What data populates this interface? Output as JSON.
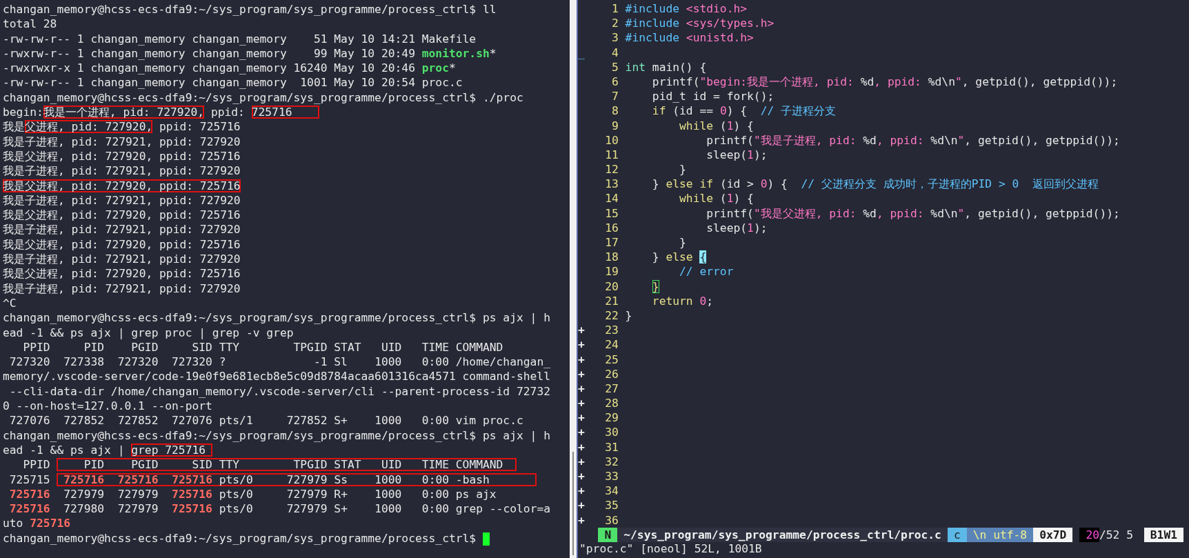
{
  "terminal": {
    "cursor": true,
    "lines": [
      {
        "segments": [
          {
            "kind": "plain",
            "text": "changan_memory@hcss-ecs-dfa9:~/sys_program/sys_programme/process_ctrl$ ll"
          }
        ]
      },
      {
        "segments": [
          {
            "kind": "plain",
            "text": "total 28"
          }
        ]
      },
      {
        "segments": [
          {
            "kind": "plain",
            "text": "-rw-rw-r-- 1 changan_memory changan_memory    51 May 10 14:21 Makefile"
          }
        ]
      },
      {
        "segments": [
          {
            "kind": "plain",
            "text": "-rwxrw-r-- 1 changan_memory changan_memory    99 May 10 20:49 "
          },
          {
            "kind": "exec",
            "text": "monitor.sh"
          },
          {
            "kind": "plain",
            "text": "*"
          }
        ]
      },
      {
        "segments": [
          {
            "kind": "plain",
            "text": "-rwxrwxr-x 1 changan_memory changan_memory 16240 May 10 20:46 "
          },
          {
            "kind": "exec",
            "text": "proc"
          },
          {
            "kind": "plain",
            "text": "*"
          }
        ]
      },
      {
        "segments": [
          {
            "kind": "plain",
            "text": "-rw-rw-r-- 1 changan_memory changan_memory  1001 May 10 20:54 proc.c"
          }
        ]
      },
      {
        "segments": [
          {
            "kind": "plain",
            "text": "changan_memory@hcss-ecs-dfa9:~/sys_program/sys_programme/process_ctrl$ ./proc"
          }
        ]
      },
      {
        "segments": [
          {
            "kind": "plain",
            "text": "begin:"
          },
          {
            "kind": "box",
            "segments": [
              {
                "kind": "plain",
                "text": "我是一个进程, pid: 727920,"
              }
            ]
          },
          {
            "kind": "plain",
            "text": " ppid: "
          },
          {
            "kind": "box",
            "segments": [
              {
                "kind": "plain",
                "text": "725716    "
              }
            ]
          }
        ]
      },
      {
        "segments": [
          {
            "kind": "plain",
            "text": "我是"
          },
          {
            "kind": "box",
            "segments": [
              {
                "kind": "plain",
                "text": "父进程, pid: 727920,"
              }
            ]
          },
          {
            "kind": "plain",
            "text": " ppid: 725716"
          }
        ]
      },
      {
        "segments": [
          {
            "kind": "plain",
            "text": "我是子进程, pid: 727921, ppid: 727920"
          }
        ]
      },
      {
        "segments": [
          {
            "kind": "plain",
            "text": "我是父进程, pid: 727920, ppid: 725716"
          }
        ]
      },
      {
        "segments": [
          {
            "kind": "plain",
            "text": "我是子进程, pid: 727921, ppid: 727920"
          }
        ]
      },
      {
        "segments": [
          {
            "kind": "box",
            "segments": [
              {
                "kind": "plain",
                "text": "我是父进程, pid: 727920, ppid: 725716"
              }
            ]
          }
        ]
      },
      {
        "segments": [
          {
            "kind": "plain",
            "text": "我是子进程, pid: 727921, ppid: 727920"
          }
        ]
      },
      {
        "segments": [
          {
            "kind": "plain",
            "text": "我是父进程, pid: 727920, ppid: 725716"
          }
        ]
      },
      {
        "segments": [
          {
            "kind": "plain",
            "text": "我是子进程, pid: 727921, ppid: 727920"
          }
        ]
      },
      {
        "segments": [
          {
            "kind": "plain",
            "text": "我是父进程, pid: 727920, ppid: 725716"
          }
        ]
      },
      {
        "segments": [
          {
            "kind": "plain",
            "text": "我是子进程, pid: 727921, ppid: 727920"
          }
        ]
      },
      {
        "segments": [
          {
            "kind": "plain",
            "text": "我是父进程, pid: 727920, ppid: 725716"
          }
        ]
      },
      {
        "segments": [
          {
            "kind": "plain",
            "text": "我是子进程, pid: 727921, ppid: 727920"
          }
        ]
      },
      {
        "segments": [
          {
            "kind": "plain",
            "text": "^C"
          }
        ]
      },
      {
        "segments": [
          {
            "kind": "plain",
            "text": "changan_memory@hcss-ecs-dfa9:~/sys_program/sys_programme/process_ctrl$ ps ajx | h"
          }
        ]
      },
      {
        "segments": [
          {
            "kind": "plain",
            "text": "ead -1 && ps ajx | grep proc | grep -v grep"
          }
        ]
      },
      {
        "segments": [
          {
            "kind": "plain",
            "text": "   PPID     PID    PGID     SID TTY        TPGID STAT   UID   TIME COMMAND"
          }
        ]
      },
      {
        "segments": [
          {
            "kind": "plain",
            "text": " 727320  727338  727320  727320 ?             -1 Sl    1000   0:00 /home/changan_"
          }
        ]
      },
      {
        "segments": [
          {
            "kind": "plain",
            "text": "memory/.vscode-server/code-19e0f9e681ecb8e5c09d8784acaa601316ca4571 command-shell"
          }
        ]
      },
      {
        "segments": [
          {
            "kind": "plain",
            "text": " --cli-data-dir /home/changan_memory/.vscode-server/cli --parent-process-id 72732"
          }
        ]
      },
      {
        "segments": [
          {
            "kind": "plain",
            "text": "0 --on-host=127.0.0.1 --on-port"
          }
        ]
      },
      {
        "segments": [
          {
            "kind": "plain",
            "text": " 727076  727852  727852  727076 pts/1     727852 S+    1000   0:00 vim proc.c"
          }
        ]
      },
      {
        "segments": [
          {
            "kind": "plain",
            "text": "changan_memory@hcss-ecs-dfa9:~/sys_program/sys_programme/process_ctrl$ ps ajx | h"
          }
        ]
      },
      {
        "segments": [
          {
            "kind": "plain",
            "text": "ead -1 && ps ajx | "
          },
          {
            "kind": "box",
            "segments": [
              {
                "kind": "plain",
                "text": "grep 725716 "
              }
            ]
          }
        ]
      },
      {
        "segments": [
          {
            "kind": "plain",
            "text": "   PPID "
          },
          {
            "kind": "box",
            "segments": [
              {
                "kind": "plain",
                "text": "    PID    PGID     SID TTY        TPGID STAT   UID   TIME COMMAND  "
              }
            ]
          }
        ]
      },
      {
        "segments": [
          {
            "kind": "plain",
            "text": " 725715 "
          },
          {
            "kind": "box",
            "segments": [
              {
                "kind": "match",
                "text": " 725716"
              },
              {
                "kind": "match",
                "text": "  725716"
              },
              {
                "kind": "match",
                "text": "  725716"
              },
              {
                "kind": "plain",
                "text": " pts/0     727979 Ss    1000   0:00 -bash       "
              }
            ]
          }
        ]
      },
      {
        "segments": [
          {
            "kind": "match",
            "text": " 725716"
          },
          {
            "kind": "plain",
            "text": "  727979  727979  "
          },
          {
            "kind": "match",
            "text": "725716"
          },
          {
            "kind": "plain",
            "text": " pts/0     727979 R+    1000   0:00 ps ajx"
          }
        ]
      },
      {
        "segments": [
          {
            "kind": "match",
            "text": " 725716"
          },
          {
            "kind": "plain",
            "text": "  727980  727979  "
          },
          {
            "kind": "match",
            "text": "725716"
          },
          {
            "kind": "plain",
            "text": " pts/0     727979 S+    1000   0:00 grep --color=a"
          }
        ]
      },
      {
        "segments": [
          {
            "kind": "plain",
            "text": "uto "
          },
          {
            "kind": "match",
            "text": "725716"
          }
        ]
      },
      {
        "segments": [
          {
            "kind": "plain",
            "text": "changan_memory@hcss-ecs-dfa9:~/sys_program/sys_programme/process_ctrl$ "
          }
        ]
      }
    ]
  },
  "editor": {
    "lines": [
      {
        "number": "1",
        "segments": [
          {
            "kind": "preproc",
            "text": "#include"
          },
          {
            "kind": "header",
            "text": " <stdio.h>"
          }
        ]
      },
      {
        "number": "2",
        "segments": [
          {
            "kind": "preproc",
            "text": "#include"
          },
          {
            "kind": "header",
            "text": " <sys/types.h>"
          }
        ]
      },
      {
        "number": "3",
        "segments": [
          {
            "kind": "preproc",
            "text": "#include"
          },
          {
            "kind": "header",
            "text": " <unistd.h>"
          }
        ]
      },
      {
        "sign": "_",
        "number": "4"
      },
      {
        "number": "5",
        "segments": [
          {
            "kind": "type",
            "text": "int"
          },
          {
            "kind": "plain",
            "text": " main() {"
          }
        ]
      },
      {
        "number": "6",
        "segments": [
          {
            "kind": "plain",
            "text": "    printf("
          },
          {
            "kind": "string",
            "text": "\"begin:我是一个进程, pid: "
          },
          {
            "kind": "plain",
            "text": "%d"
          },
          {
            "kind": "string",
            "text": ", ppid: "
          },
          {
            "kind": "plain",
            "text": "%d\\n"
          },
          {
            "kind": "string",
            "text": "\""
          },
          {
            "kind": "plain",
            "text": ", getpid(), getppid());"
          }
        ]
      },
      {
        "number": "7",
        "segments": [
          {
            "kind": "plain",
            "text": "    pid_t id = fork();"
          }
        ]
      },
      {
        "number": "8",
        "segments": [
          {
            "kind": "keyword",
            "text": "    if"
          },
          {
            "kind": "plain",
            "text": " (id == "
          },
          {
            "kind": "number",
            "text": "0"
          },
          {
            "kind": "plain",
            "text": ") {  "
          },
          {
            "kind": "comment",
            "text": "// 子进程分支"
          }
        ]
      },
      {
        "number": "9",
        "segments": [
          {
            "kind": "keyword",
            "text": "        while"
          },
          {
            "kind": "plain",
            "text": " ("
          },
          {
            "kind": "number",
            "text": "1"
          },
          {
            "kind": "plain",
            "text": ") {"
          }
        ]
      },
      {
        "number": "10",
        "segments": [
          {
            "kind": "plain",
            "text": "            printf("
          },
          {
            "kind": "string",
            "text": "\"我是子进程, pid: "
          },
          {
            "kind": "plain",
            "text": "%d"
          },
          {
            "kind": "string",
            "text": ", ppid: "
          },
          {
            "kind": "plain",
            "text": "%d\\n"
          },
          {
            "kind": "string",
            "text": "\""
          },
          {
            "kind": "plain",
            "text": ", getpid(), getppid());"
          }
        ]
      },
      {
        "number": "11",
        "segments": [
          {
            "kind": "plain",
            "text": "            sleep("
          },
          {
            "kind": "number",
            "text": "1"
          },
          {
            "kind": "plain",
            "text": ");"
          }
        ]
      },
      {
        "number": "12",
        "segments": [
          {
            "kind": "plain",
            "text": "        }"
          }
        ]
      },
      {
        "number": "13",
        "segments": [
          {
            "kind": "plain",
            "text": "    } "
          },
          {
            "kind": "keyword",
            "text": "else if"
          },
          {
            "kind": "plain",
            "text": " (id > "
          },
          {
            "kind": "number",
            "text": "0"
          },
          {
            "kind": "plain",
            "text": ") {  "
          },
          {
            "kind": "comment",
            "text": "// 父进程分支 成功时，子进程的PID > 0  返回到父进程"
          }
        ]
      },
      {
        "number": "14",
        "segments": [
          {
            "kind": "keyword",
            "text": "        while"
          },
          {
            "kind": "plain",
            "text": " ("
          },
          {
            "kind": "number",
            "text": "1"
          },
          {
            "kind": "plain",
            "text": ") {"
          }
        ]
      },
      {
        "number": "15",
        "segments": [
          {
            "kind": "plain",
            "text": "            printf("
          },
          {
            "kind": "string",
            "text": "\"我是父进程, pid: "
          },
          {
            "kind": "plain",
            "text": "%d"
          },
          {
            "kind": "string",
            "text": ", ppid: "
          },
          {
            "kind": "plain",
            "text": "%d\\n"
          },
          {
            "kind": "string",
            "text": "\""
          },
          {
            "kind": "plain",
            "text": ", getpid(), getppid());"
          }
        ]
      },
      {
        "number": "16",
        "segments": [
          {
            "kind": "plain",
            "text": "            sleep("
          },
          {
            "kind": "number",
            "text": "1"
          },
          {
            "kind": "plain",
            "text": ");"
          }
        ]
      },
      {
        "number": "17",
        "segments": [
          {
            "kind": "plain",
            "text": "        }"
          }
        ]
      },
      {
        "number": "18",
        "segments": [
          {
            "kind": "plain",
            "text": "    } "
          },
          {
            "kind": "keyword",
            "text": "else"
          },
          {
            "kind": "cursor",
            "text": " {"
          }
        ]
      },
      {
        "number": "19",
        "segments": [
          {
            "kind": "comment",
            "text": "        // error"
          }
        ]
      },
      {
        "number": "20",
        "segments": [
          {
            "kind": "match-paren",
            "text": "    }"
          }
        ]
      },
      {
        "number": "21",
        "segments": [
          {
            "kind": "keyword",
            "text": "    return"
          },
          {
            "kind": "number",
            "text": " 0"
          },
          {
            "kind": "plain",
            "text": ";"
          }
        ]
      },
      {
        "number": "22",
        "segments": [
          {
            "kind": "plain",
            "text": "}"
          }
        ]
      },
      {
        "sign": "+",
        "number": "23"
      },
      {
        "sign": "+",
        "number": "24"
      },
      {
        "sign": "+",
        "number": "25"
      },
      {
        "sign": "+",
        "number": "26"
      },
      {
        "sign": "+",
        "number": "27"
      },
      {
        "sign": "+",
        "number": "28"
      },
      {
        "sign": "+",
        "number": "29"
      },
      {
        "sign": "+",
        "number": "30"
      },
      {
        "sign": "+",
        "number": "31"
      },
      {
        "sign": "+",
        "number": "32"
      },
      {
        "sign": "+",
        "number": "33"
      },
      {
        "sign": "+",
        "number": "34"
      },
      {
        "sign": "+",
        "number": "35"
      },
      {
        "sign": "+",
        "number": "36"
      }
    ],
    "status_bar": [
      {
        "kind": "mode",
        "text": "N"
      },
      {
        "kind": "path",
        "text": "~/sys_program/sys_programme/process_ctrl/proc.c"
      },
      {
        "kind": "filetype",
        "text": "c"
      },
      {
        "kind": "encoding",
        "text": "\\n utf-8"
      },
      {
        "kind": "charcode",
        "text": "0x7D"
      },
      {
        "kind": "line",
        "text": "20"
      },
      {
        "kind": "position",
        "text": "/52 5"
      },
      {
        "kind": "buffer",
        "text": "B1W1"
      }
    ],
    "message": "\"proc.c\" [noeol] 52L, 1001B"
  }
}
